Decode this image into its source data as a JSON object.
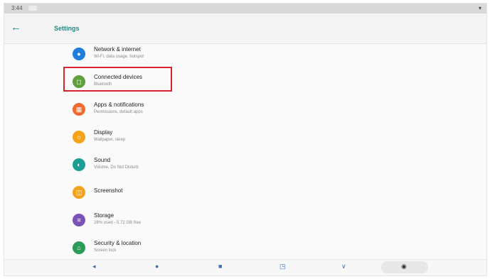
{
  "status": {
    "time": "3:44"
  },
  "header": {
    "title": "Settings"
  },
  "items": [
    {
      "title": "Network & internet",
      "subtitle": "Wi-Fi, data usage, hotspot",
      "color": "#1f7ddb",
      "icon": "wifi-icon"
    },
    {
      "title": "Connected devices",
      "subtitle": "Bluetooth",
      "color": "#5f9f3c",
      "icon": "devices-icon"
    },
    {
      "title": "Apps & notifications",
      "subtitle": "Permissions, default apps",
      "color": "#ef6b2f",
      "icon": "apps-icon"
    },
    {
      "title": "Display",
      "subtitle": "Wallpaper, sleep",
      "color": "#f3a419",
      "icon": "display-icon"
    },
    {
      "title": "Sound",
      "subtitle": "Volume, Do Not Disturb",
      "color": "#1c9d95",
      "icon": "sound-icon"
    },
    {
      "title": "Screenshot",
      "subtitle": "",
      "color": "#f4a21b",
      "icon": "screenshot-icon"
    },
    {
      "title": "Storage",
      "subtitle": "28% used - 5.72 GB free",
      "color": "#7c52b8",
      "icon": "storage-icon"
    },
    {
      "title": "Security & location",
      "subtitle": "Screen lock",
      "color": "#2d9a55",
      "icon": "security-icon"
    }
  ],
  "colors": {
    "accent": "#1f8a84",
    "highlight": "#d92430"
  }
}
